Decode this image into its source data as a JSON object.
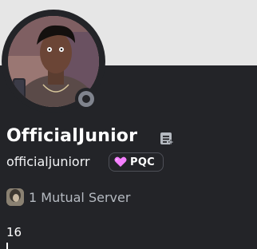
{
  "profile": {
    "display_name": "OfficialJunior",
    "username": "officialjuniorr",
    "badge_tag": "PQC",
    "status": "offline",
    "bio": "16"
  },
  "mutual": {
    "label": "1 Mutual Server"
  },
  "colors": {
    "banner": "#e6e6e6",
    "background": "#232428",
    "status_offline": "#80848e",
    "badge_heart": "#f47fff"
  },
  "icons": {
    "name_icon": "note-icon",
    "badge_icon": "heart-icon",
    "status_icon": "offline-status-icon"
  }
}
